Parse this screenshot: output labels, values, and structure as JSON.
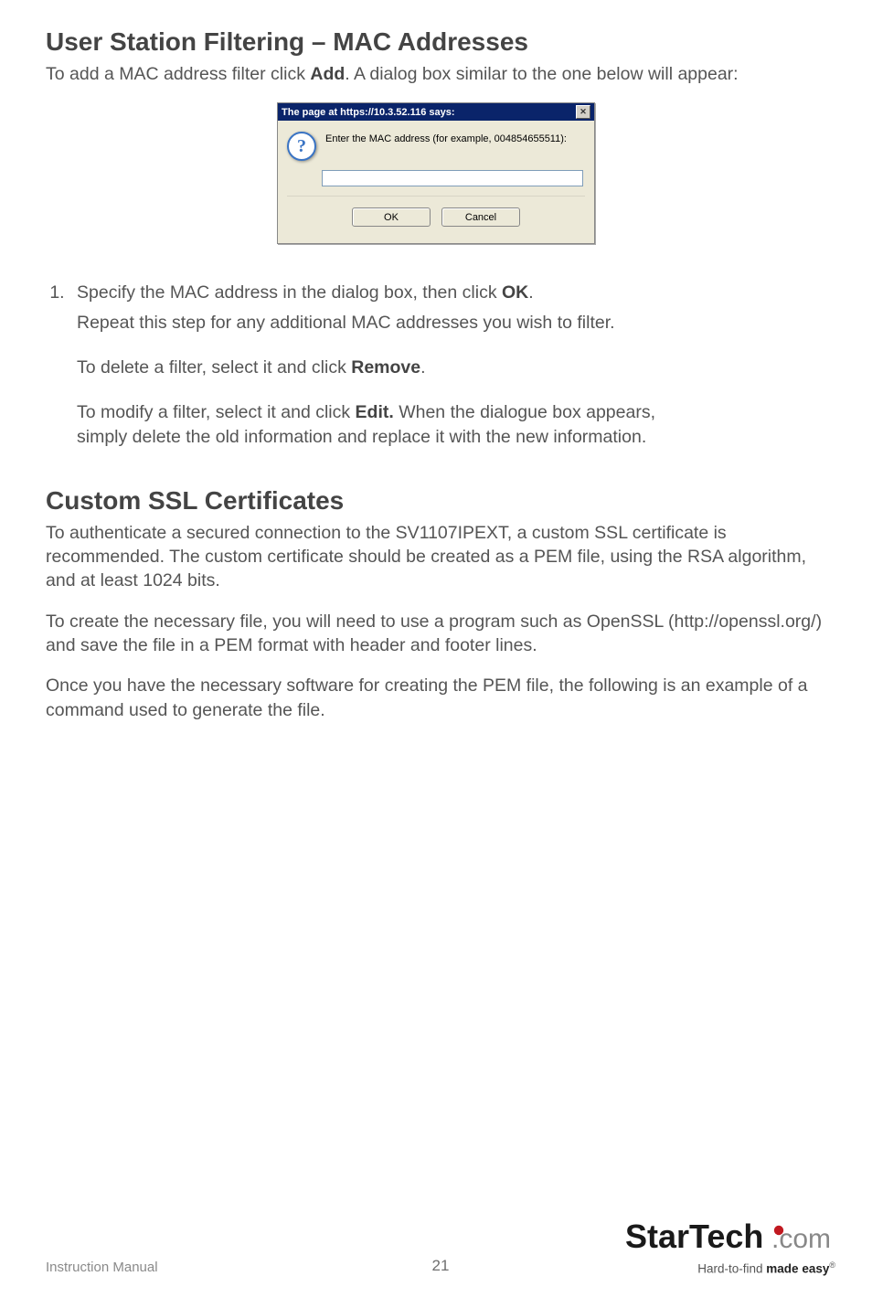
{
  "section1": {
    "heading": "User Station Filtering – MAC Addresses",
    "intro_pre": "To add a MAC address filter click ",
    "intro_bold": "Add",
    "intro_post": ". A dialog box similar to the one below will appear:"
  },
  "dialog": {
    "title": "The page at https://10.3.52.116 says:",
    "close_glyph": "✕",
    "question_glyph": "?",
    "prompt": "Enter the MAC address (for example, 004854655511):",
    "input_value": "",
    "ok_label": "OK",
    "cancel_label": "Cancel"
  },
  "steps": {
    "item1_pre": "Specify the MAC address in the dialog box, then click ",
    "item1_bold": "OK",
    "item1_post": ".",
    "repeat": "Repeat this step for any additional MAC addresses you wish to filter.",
    "delete_pre": "To delete a filter, select it and click ",
    "delete_bold": "Remove",
    "delete_post": ".",
    "modify_pre": "To modify a filter, select it and click ",
    "modify_bold": "Edit.",
    "modify_post": " When the dialogue box appears, simply delete the old information and replace it with the new information."
  },
  "section2": {
    "heading": "Custom SSL Certificates",
    "p1": "To authenticate a secured connection to the SV1107IPEXT, a custom SSL certificate is recommended. The custom certificate should be created as a PEM file, using the RSA algorithm, and at least 1024 bits.",
    "p2": "To create the necessary file, you will need to use a program such as OpenSSL (http://openssl.org/) and save the file in a PEM format with header and footer lines.",
    "p3": "Once you have the necessary software for creating the PEM file, the following is an example of a command used to generate the file."
  },
  "footer": {
    "left": "Instruction Manual",
    "page": "21",
    "logo_text": "StarTech.com",
    "tag_pre": "Hard-to-find ",
    "tag_bold": "made easy",
    "tag_reg": "®"
  }
}
